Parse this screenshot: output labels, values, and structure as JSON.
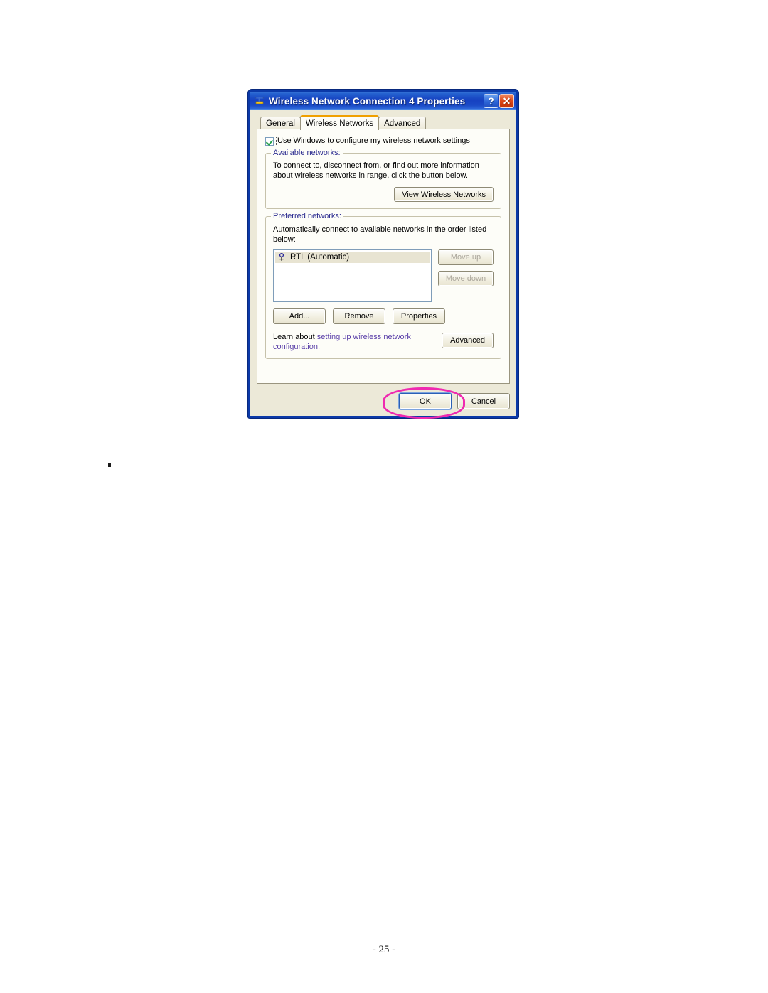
{
  "page": {
    "page_number": "- 25 -",
    "stray_mark": "."
  },
  "dialog": {
    "title": "Wireless Network Connection 4 Properties",
    "titlebar_icon": "network-adapter-icon",
    "help_button": "?",
    "close_button": "✕",
    "tabs": [
      {
        "label": "General",
        "active": false
      },
      {
        "label": "Wireless Networks",
        "active": true
      },
      {
        "label": "Advanced",
        "active": false
      }
    ],
    "use_windows_checkbox": {
      "checked": true,
      "label_before": "U",
      "label_accel": "se ",
      "label_text": "Use Windows to configure my wireless network settings"
    },
    "available_networks": {
      "group_title": "Available networks:",
      "description": "To connect to, disconnect from, or find out more information about wireless networks in range, click the button below.",
      "view_button": "View Wireless Networks"
    },
    "preferred_networks": {
      "group_title": "Preferred networks:",
      "description": "Automatically connect to available networks in the order listed below:",
      "items": [
        {
          "name": "RTL (Automatic)",
          "icon": "wireless-signal-icon",
          "selected": true
        }
      ],
      "move_up_button": "Move up",
      "move_down_button": "Move down",
      "move_up_enabled": false,
      "move_down_enabled": false,
      "add_button": "Add...",
      "remove_button": "Remove",
      "properties_button": "Properties"
    },
    "learn_about": {
      "prefix": "Learn about ",
      "link_text": "setting up wireless network configuration.",
      "advanced_button": "Advanced"
    },
    "footer": {
      "ok_button": "OK",
      "cancel_button": "Cancel"
    },
    "annotation": {
      "shape": "ellipse",
      "target": "OK",
      "color": "#ef2ab0"
    }
  }
}
